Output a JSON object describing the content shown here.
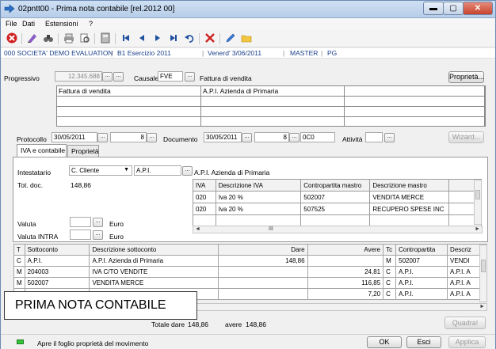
{
  "window": {
    "title": "02pntt00 - Prima nota contabile [rel.2012 00]",
    "minimize": "▬",
    "maximize": "▢",
    "close": "✕"
  },
  "menu": [
    "File",
    "Dati",
    "Estensioni",
    "?"
  ],
  "toolbar": {
    "icons": [
      "delete-icon",
      "edit-icon",
      "binoculars-icon",
      "print-icon",
      "print-preview-icon",
      "calculator-icon",
      "first-record-icon",
      "previous-record-icon",
      "next-record-icon",
      "last-record-icon",
      "undo-icon",
      "cancel-icon",
      "pencil-icon",
      "folder-icon"
    ]
  },
  "status_info": {
    "company": "000 SOCIETA' DEMO EVALUATION",
    "year": "B1 Esercizio 2011",
    "date": "Venerd' 3/06/2011",
    "user": "MASTER",
    "mode": "PG"
  },
  "header": {
    "progressivo_label": "Progressivo",
    "progressivo_value": "12.345.688",
    "causale_label": "Causale",
    "causale_value": "FVE",
    "causale_desc": "Fattura di vendita",
    "properties_button": "Proprietà...",
    "grid_cells": [
      "Fattura di vendita",
      "A.P.I. Azienda di Primaria",
      "",
      "",
      "",
      "",
      "",
      "",
      "",
      "",
      "",
      ""
    ],
    "protocollo_label": "Protocollo",
    "protocollo_date": "30/05/2011",
    "protocollo_number": "8",
    "documento_label": "Documento",
    "documento_date": "30/05/2011",
    "documento_number": "8",
    "documento_series": "0C0",
    "attivita_label": "Attività",
    "wizard_button": "Wizard...",
    "dots": "..."
  },
  "tabs": [
    "IVA e contabile",
    "Proprietà"
  ],
  "iva_panel": {
    "intestatario_label": "Intestatario",
    "intestatario_type": "C. Cliente",
    "intestatario_code": "A.P.I.",
    "intestatario_name": "A.P.I. Azienda di Primaria",
    "tot_doc_label": "Tot. doc.",
    "tot_doc_value": "148,86",
    "valuta_label": "Valuta",
    "valuta_currency": "Euro",
    "valuta_intra_label": "Valuta INTRA",
    "valuta_intra_currency": "Euro",
    "iva_headers": [
      "IVA",
      "Descrizione IVA",
      "Contropartita mastro",
      "Descrizione mastro"
    ],
    "iva_rows": [
      [
        "020",
        "Iva 20 %",
        "502007",
        "VENDITA MERCE"
      ],
      [
        "020",
        "Iva 20 %",
        "507525",
        "RECUPERO SPESE INC"
      ],
      [
        "",
        "",
        "",
        ""
      ]
    ],
    "scroll_glyph": "III"
  },
  "movements": {
    "headers": [
      "T",
      "Sottoconto",
      "Descrizione sottoconto",
      "Dare",
      "Avere",
      "Tc",
      "Contropartita",
      "Descriz"
    ],
    "rows": [
      [
        "C",
        "A.P.I.",
        "A.P.I. Azienda di Primaria",
        "148,86",
        "",
        "M",
        "502007",
        "VENDI"
      ],
      [
        "M",
        "204003",
        "IVA C/TO VENDITE",
        "",
        "24,81",
        "C",
        "A.P.I.",
        "A.P.I. A"
      ],
      [
        "M",
        "502007",
        "VENDITA MERCE",
        "",
        "116,85",
        "C",
        "A.P.I.",
        "A.P.I. A"
      ],
      [
        "",
        "",
        "",
        "",
        "7,20",
        "C",
        "A.P.I.",
        "A.P.I. A"
      ]
    ],
    "totale_dare_label": "Totale dare",
    "totale_dare_value": "148,86",
    "totale_avere_label": "avere",
    "totale_avere_value": "148,86",
    "quadra_button": "Quadra!"
  },
  "overlay_label": "PRIMA NOTA CONTABILE",
  "bottom": {
    "hint": "Apre il foglio proprietà del movimento",
    "ok": "OK",
    "esci": "Esci",
    "applica": "Applica"
  },
  "colors": {
    "accent": "#1a3f8a",
    "status_led": "#35c43a",
    "delete_red": "#d02020"
  }
}
